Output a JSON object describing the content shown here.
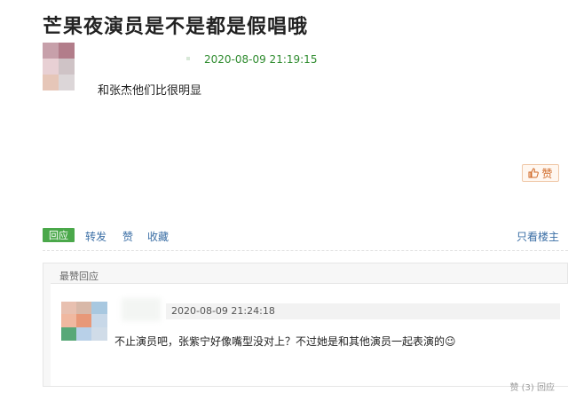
{
  "post": {
    "title": "芒果夜演员是不是都是假唱哦",
    "timestamp": "2020-08-09 21:19:15",
    "text": "和张杰他们比很明显",
    "like_label": "赞"
  },
  "actions": {
    "reply": "回应",
    "repost": "转发",
    "like": "赞",
    "collect": "收藏",
    "only_host": "只看楼主"
  },
  "replies": {
    "header": "最赞回应",
    "items": [
      {
        "timestamp": "2020-08-09 21:24:18",
        "text": "不止演员吧，张紫宁好像嘴型没对上？不过她是和其他演员一起表演的😉",
        "footer": "赞 (3)   回应"
      }
    ]
  },
  "colors": {
    "green": "#4aa84a",
    "link": "#3a6ea5",
    "timestamp_green": "#2e8b2e",
    "like_orange": "#d06a28"
  },
  "icons": [
    "thumbs-up-icon",
    "wink-emoji-icon"
  ]
}
